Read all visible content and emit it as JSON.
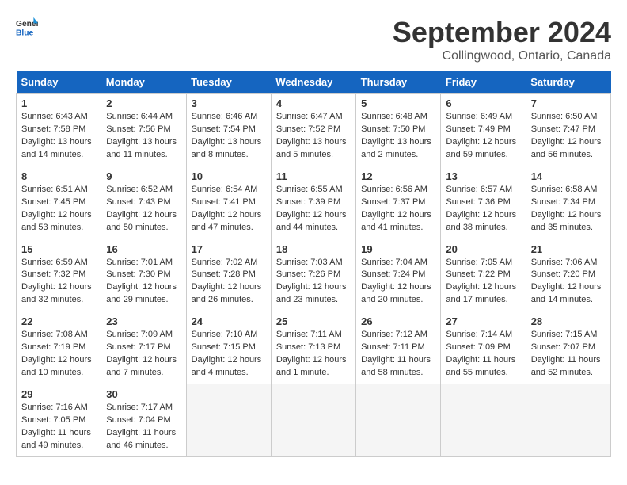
{
  "header": {
    "logo_general": "General",
    "logo_blue": "Blue",
    "month_title": "September 2024",
    "location": "Collingwood, Ontario, Canada"
  },
  "weekdays": [
    "Sunday",
    "Monday",
    "Tuesday",
    "Wednesday",
    "Thursday",
    "Friday",
    "Saturday"
  ],
  "weeks": [
    [
      {
        "day": "1",
        "sunrise": "Sunrise: 6:43 AM",
        "sunset": "Sunset: 7:58 PM",
        "daylight": "Daylight: 13 hours and 14 minutes."
      },
      {
        "day": "2",
        "sunrise": "Sunrise: 6:44 AM",
        "sunset": "Sunset: 7:56 PM",
        "daylight": "Daylight: 13 hours and 11 minutes."
      },
      {
        "day": "3",
        "sunrise": "Sunrise: 6:46 AM",
        "sunset": "Sunset: 7:54 PM",
        "daylight": "Daylight: 13 hours and 8 minutes."
      },
      {
        "day": "4",
        "sunrise": "Sunrise: 6:47 AM",
        "sunset": "Sunset: 7:52 PM",
        "daylight": "Daylight: 13 hours and 5 minutes."
      },
      {
        "day": "5",
        "sunrise": "Sunrise: 6:48 AM",
        "sunset": "Sunset: 7:50 PM",
        "daylight": "Daylight: 13 hours and 2 minutes."
      },
      {
        "day": "6",
        "sunrise": "Sunrise: 6:49 AM",
        "sunset": "Sunset: 7:49 PM",
        "daylight": "Daylight: 12 hours and 59 minutes."
      },
      {
        "day": "7",
        "sunrise": "Sunrise: 6:50 AM",
        "sunset": "Sunset: 7:47 PM",
        "daylight": "Daylight: 12 hours and 56 minutes."
      }
    ],
    [
      {
        "day": "8",
        "sunrise": "Sunrise: 6:51 AM",
        "sunset": "Sunset: 7:45 PM",
        "daylight": "Daylight: 12 hours and 53 minutes."
      },
      {
        "day": "9",
        "sunrise": "Sunrise: 6:52 AM",
        "sunset": "Sunset: 7:43 PM",
        "daylight": "Daylight: 12 hours and 50 minutes."
      },
      {
        "day": "10",
        "sunrise": "Sunrise: 6:54 AM",
        "sunset": "Sunset: 7:41 PM",
        "daylight": "Daylight: 12 hours and 47 minutes."
      },
      {
        "day": "11",
        "sunrise": "Sunrise: 6:55 AM",
        "sunset": "Sunset: 7:39 PM",
        "daylight": "Daylight: 12 hours and 44 minutes."
      },
      {
        "day": "12",
        "sunrise": "Sunrise: 6:56 AM",
        "sunset": "Sunset: 7:37 PM",
        "daylight": "Daylight: 12 hours and 41 minutes."
      },
      {
        "day": "13",
        "sunrise": "Sunrise: 6:57 AM",
        "sunset": "Sunset: 7:36 PM",
        "daylight": "Daylight: 12 hours and 38 minutes."
      },
      {
        "day": "14",
        "sunrise": "Sunrise: 6:58 AM",
        "sunset": "Sunset: 7:34 PM",
        "daylight": "Daylight: 12 hours and 35 minutes."
      }
    ],
    [
      {
        "day": "15",
        "sunrise": "Sunrise: 6:59 AM",
        "sunset": "Sunset: 7:32 PM",
        "daylight": "Daylight: 12 hours and 32 minutes."
      },
      {
        "day": "16",
        "sunrise": "Sunrise: 7:01 AM",
        "sunset": "Sunset: 7:30 PM",
        "daylight": "Daylight: 12 hours and 29 minutes."
      },
      {
        "day": "17",
        "sunrise": "Sunrise: 7:02 AM",
        "sunset": "Sunset: 7:28 PM",
        "daylight": "Daylight: 12 hours and 26 minutes."
      },
      {
        "day": "18",
        "sunrise": "Sunrise: 7:03 AM",
        "sunset": "Sunset: 7:26 PM",
        "daylight": "Daylight: 12 hours and 23 minutes."
      },
      {
        "day": "19",
        "sunrise": "Sunrise: 7:04 AM",
        "sunset": "Sunset: 7:24 PM",
        "daylight": "Daylight: 12 hours and 20 minutes."
      },
      {
        "day": "20",
        "sunrise": "Sunrise: 7:05 AM",
        "sunset": "Sunset: 7:22 PM",
        "daylight": "Daylight: 12 hours and 17 minutes."
      },
      {
        "day": "21",
        "sunrise": "Sunrise: 7:06 AM",
        "sunset": "Sunset: 7:20 PM",
        "daylight": "Daylight: 12 hours and 14 minutes."
      }
    ],
    [
      {
        "day": "22",
        "sunrise": "Sunrise: 7:08 AM",
        "sunset": "Sunset: 7:19 PM",
        "daylight": "Daylight: 12 hours and 10 minutes."
      },
      {
        "day": "23",
        "sunrise": "Sunrise: 7:09 AM",
        "sunset": "Sunset: 7:17 PM",
        "daylight": "Daylight: 12 hours and 7 minutes."
      },
      {
        "day": "24",
        "sunrise": "Sunrise: 7:10 AM",
        "sunset": "Sunset: 7:15 PM",
        "daylight": "Daylight: 12 hours and 4 minutes."
      },
      {
        "day": "25",
        "sunrise": "Sunrise: 7:11 AM",
        "sunset": "Sunset: 7:13 PM",
        "daylight": "Daylight: 12 hours and 1 minute."
      },
      {
        "day": "26",
        "sunrise": "Sunrise: 7:12 AM",
        "sunset": "Sunset: 7:11 PM",
        "daylight": "Daylight: 11 hours and 58 minutes."
      },
      {
        "day": "27",
        "sunrise": "Sunrise: 7:14 AM",
        "sunset": "Sunset: 7:09 PM",
        "daylight": "Daylight: 11 hours and 55 minutes."
      },
      {
        "day": "28",
        "sunrise": "Sunrise: 7:15 AM",
        "sunset": "Sunset: 7:07 PM",
        "daylight": "Daylight: 11 hours and 52 minutes."
      }
    ],
    [
      {
        "day": "29",
        "sunrise": "Sunrise: 7:16 AM",
        "sunset": "Sunset: 7:05 PM",
        "daylight": "Daylight: 11 hours and 49 minutes."
      },
      {
        "day": "30",
        "sunrise": "Sunrise: 7:17 AM",
        "sunset": "Sunset: 7:04 PM",
        "daylight": "Daylight: 11 hours and 46 minutes."
      },
      null,
      null,
      null,
      null,
      null
    ]
  ]
}
